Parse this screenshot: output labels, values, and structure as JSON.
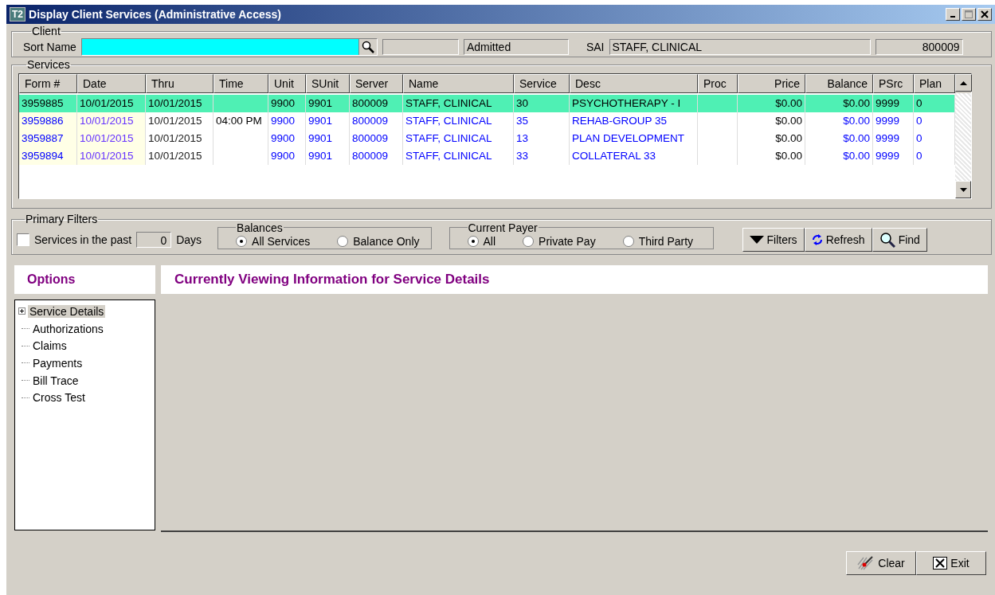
{
  "window": {
    "title": "Display Client Services (Administrative Access)",
    "app_badge": "T2"
  },
  "client": {
    "label": "Client",
    "sort_name_label": "Sort Name",
    "status": "Admitted",
    "sai_label": "SAI",
    "sai_value": "STAFF, CLINICAL",
    "sai_id": "800009"
  },
  "services": {
    "label": "Services",
    "columns": [
      {
        "label": "Form #"
      },
      {
        "label": "Date"
      },
      {
        "label": "Thru"
      },
      {
        "label": "Time"
      },
      {
        "label": "Unit"
      },
      {
        "label": "SUnit"
      },
      {
        "label": "Server"
      },
      {
        "label": "Name"
      },
      {
        "label": "Service"
      },
      {
        "label": "Desc"
      },
      {
        "label": "Proc"
      },
      {
        "label": "Price"
      },
      {
        "label": "Balance"
      },
      {
        "label": "PSrc"
      },
      {
        "label": "Plan"
      }
    ],
    "rows": [
      {
        "selected": true,
        "cells": [
          "3959885",
          "10/01/2015",
          "10/01/2015",
          "",
          "9900",
          "9901",
          "800009",
          "STAFF, CLINICAL",
          "30",
          "PSYCHOTHERAPY - I",
          "",
          "$0.00",
          "$0.00",
          "9999",
          "0"
        ]
      },
      {
        "selected": false,
        "cells": [
          "3959886",
          "10/01/2015",
          "10/01/2015",
          "04:00 PM",
          "9900",
          "9901",
          "800009",
          "STAFF, CLINICAL",
          "35",
          "REHAB-GROUP 35",
          "",
          "$0.00",
          "$0.00",
          "9999",
          "0"
        ]
      },
      {
        "selected": false,
        "cells": [
          "3959887",
          "10/01/2015",
          "10/01/2015",
          "",
          "9900",
          "9901",
          "800009",
          "STAFF, CLINICAL",
          "13",
          "PLAN DEVELOPMENT",
          "",
          "$0.00",
          "$0.00",
          "9999",
          "0"
        ]
      },
      {
        "selected": false,
        "cells": [
          "3959894",
          "10/01/2015",
          "10/01/2015",
          "",
          "9900",
          "9901",
          "800009",
          "STAFF, CLINICAL",
          "33",
          "COLLATERAL 33",
          "",
          "$0.00",
          "$0.00",
          "9999",
          "0"
        ]
      }
    ]
  },
  "primary_filters": {
    "label": "Primary Filters",
    "past_checkbox": {
      "label": "Services in the past",
      "checked": false
    },
    "days_value": "0",
    "days_label": "Days",
    "balances": {
      "label": "Balances",
      "options": [
        {
          "label": "All Services",
          "selected": true
        },
        {
          "label": "Balance Only",
          "selected": false
        }
      ]
    },
    "current_payer": {
      "label": "Current Payer",
      "options": [
        {
          "label": "All",
          "selected": true
        },
        {
          "label": "Private Pay",
          "selected": false
        },
        {
          "label": "Third Party",
          "selected": false
        }
      ]
    },
    "buttons": [
      {
        "kind": "filters",
        "label": "Filters"
      },
      {
        "kind": "refresh",
        "label": "Refresh"
      },
      {
        "kind": "find",
        "label": "Find"
      }
    ]
  },
  "options": {
    "title": "Options",
    "items": [
      {
        "kind": "folder",
        "label": "Service Details",
        "expanded": false,
        "selected": true
      },
      {
        "kind": "leaf",
        "label": "Authorizations",
        "selected": false
      },
      {
        "kind": "leaf",
        "label": "Claims",
        "selected": false
      },
      {
        "kind": "leaf",
        "label": "Payments",
        "selected": false
      },
      {
        "kind": "leaf",
        "label": "Bill Trace",
        "selected": false
      },
      {
        "kind": "leaf",
        "label": "Cross Test",
        "selected": false
      }
    ]
  },
  "content": {
    "title": "Currently Viewing Information for Service Details"
  },
  "footer_buttons": [
    {
      "kind": "clear",
      "label": "Clear"
    },
    {
      "kind": "exit",
      "label": "Exit"
    }
  ]
}
